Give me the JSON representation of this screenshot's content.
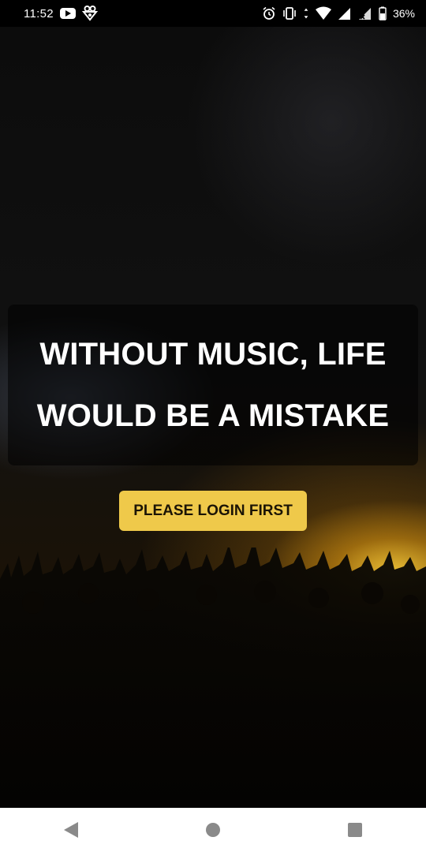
{
  "status_bar": {
    "time": "11:52",
    "battery": "36%",
    "left_icons": [
      "youtube-icon",
      "app-notification-icon"
    ],
    "right_icons": [
      "alarm-icon",
      "vibrate-icon",
      "data-arrows-icon",
      "wifi-icon",
      "signal-icon",
      "signal-no-service-icon",
      "battery-icon"
    ]
  },
  "main": {
    "headline_line1": "WITHOUT MUSIC, LIFE",
    "headline_line2": "WOULD BE A MISTAKE",
    "login_button_label": "PLEASE LOGIN FIRST"
  },
  "nav_bar": {
    "buttons": [
      "back-icon",
      "home-icon",
      "recent-apps-icon"
    ]
  },
  "colors": {
    "button_bg": "#efc94a",
    "button_text": "#1b1405",
    "stage_light": "#f2c232"
  }
}
